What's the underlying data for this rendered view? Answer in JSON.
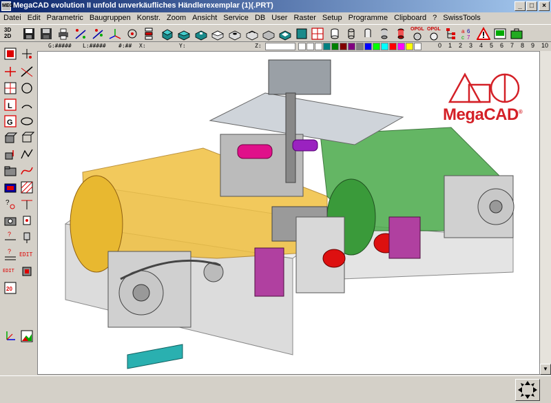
{
  "window": {
    "title": "MegaCAD evolution II unfold unverkäufliches Händlerexemplar (1)(.PRT)",
    "app_icon_label": "MEGA",
    "minimize": "_",
    "maximize": "□",
    "close": "×"
  },
  "menu": [
    {
      "label": "Datei"
    },
    {
      "label": "Edit"
    },
    {
      "label": "Parametric"
    },
    {
      "label": "Baugruppen"
    },
    {
      "label": "Konstr."
    },
    {
      "label": "Zoom"
    },
    {
      "label": "Ansicht"
    },
    {
      "label": "Service"
    },
    {
      "label": "DB"
    },
    {
      "label": "User"
    },
    {
      "label": "Raster"
    },
    {
      "label": "Setup"
    },
    {
      "label": "Programme"
    },
    {
      "label": "Clipboard"
    },
    {
      "label": "?"
    },
    {
      "label": "SwissTools"
    }
  ],
  "toolbar": {
    "view_toggle": "3D 2D",
    "ogl_label_1": "OPGL",
    "ogl_label_2": "OPGL"
  },
  "coordbar": {
    "g_field": "G:#####",
    "l_field": "L:#####",
    "sep_field": "#:##",
    "x_field": "X:",
    "y_field": "Y:",
    "z_field": "Z:"
  },
  "palette_colors": [
    "#ffffff",
    "#ffffff",
    "#ffffff",
    "#008080",
    "#008000",
    "#800000",
    "#800080",
    "#808080",
    "#0000ff",
    "#00ff00",
    "#00ffff",
    "#ff0000",
    "#ff00ff",
    "#ffff00",
    "#ffffff"
  ],
  "layer_numbers": [
    "0",
    "1",
    "2",
    "3",
    "4",
    "5",
    "6",
    "7",
    "8",
    "9",
    "10"
  ],
  "logo": {
    "text": "MegaCAD",
    "registered": "®"
  },
  "lefttools": {
    "edit_label": "EDIT",
    "edit2_label": "EDIT"
  }
}
